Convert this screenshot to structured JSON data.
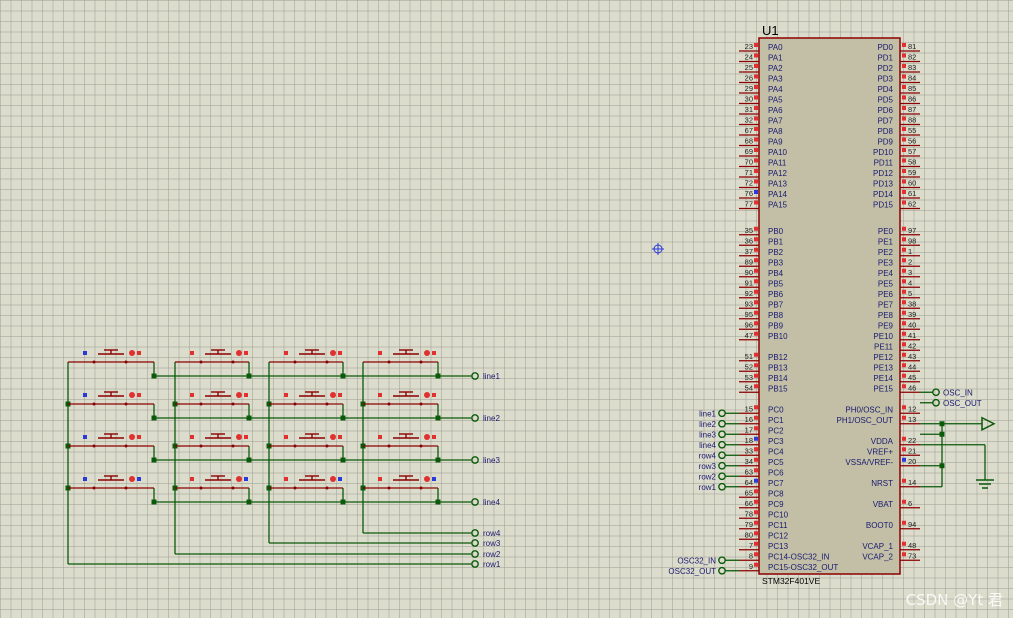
{
  "chip": {
    "ref": "U1",
    "part": "STM32F401VE",
    "left_pins": [
      {
        "num": "23",
        "name": "PA0"
      },
      {
        "num": "24",
        "name": "PA1"
      },
      {
        "num": "25",
        "name": "PA2"
      },
      {
        "num": "26",
        "name": "PA3"
      },
      {
        "num": "29",
        "name": "PA4"
      },
      {
        "num": "30",
        "name": "PA5"
      },
      {
        "num": "31",
        "name": "PA6"
      },
      {
        "num": "32",
        "name": "PA7"
      },
      {
        "num": "67",
        "name": "PA8"
      },
      {
        "num": "68",
        "name": "PA9"
      },
      {
        "num": "69",
        "name": "PA10"
      },
      {
        "num": "70",
        "name": "PA11"
      },
      {
        "num": "71",
        "name": "PA12"
      },
      {
        "num": "72",
        "name": "PA13"
      },
      {
        "num": "76",
        "name": "PA14"
      },
      {
        "num": "77",
        "name": "PA15"
      },
      {
        "num": "35",
        "name": "PB0"
      },
      {
        "num": "36",
        "name": "PB1"
      },
      {
        "num": "37",
        "name": "PB2"
      },
      {
        "num": "89",
        "name": "PB3"
      },
      {
        "num": "90",
        "name": "PB4"
      },
      {
        "num": "91",
        "name": "PB5"
      },
      {
        "num": "92",
        "name": "PB6"
      },
      {
        "num": "93",
        "name": "PB7"
      },
      {
        "num": "95",
        "name": "PB8"
      },
      {
        "num": "96",
        "name": "PB9"
      },
      {
        "num": "47",
        "name": "PB10"
      },
      {
        "num": "51",
        "name": "PB12"
      },
      {
        "num": "52",
        "name": "PB13"
      },
      {
        "num": "53",
        "name": "PB14"
      },
      {
        "num": "54",
        "name": "PB15"
      },
      {
        "num": "15",
        "name": "PC0"
      },
      {
        "num": "16",
        "name": "PC1"
      },
      {
        "num": "17",
        "name": "PC2"
      },
      {
        "num": "18",
        "name": "PC3"
      },
      {
        "num": "33",
        "name": "PC4"
      },
      {
        "num": "34",
        "name": "PC5"
      },
      {
        "num": "63",
        "name": "PC6"
      },
      {
        "num": "64",
        "name": "PC7"
      },
      {
        "num": "65",
        "name": "PC8"
      },
      {
        "num": "66",
        "name": "PC9"
      },
      {
        "num": "78",
        "name": "PC10"
      },
      {
        "num": "79",
        "name": "PC11"
      },
      {
        "num": "80",
        "name": "PC12"
      },
      {
        "num": "7",
        "name": "PC13"
      },
      {
        "num": "8",
        "name": "PC14-OSC32_IN"
      },
      {
        "num": "9",
        "name": "PC15-OSC32_OUT"
      }
    ],
    "right_pins": [
      {
        "num": "81",
        "name": "PD0"
      },
      {
        "num": "82",
        "name": "PD1"
      },
      {
        "num": "83",
        "name": "PD2"
      },
      {
        "num": "84",
        "name": "PD3"
      },
      {
        "num": "85",
        "name": "PD4"
      },
      {
        "num": "86",
        "name": "PD5"
      },
      {
        "num": "87",
        "name": "PD6"
      },
      {
        "num": "88",
        "name": "PD7"
      },
      {
        "num": "55",
        "name": "PD8"
      },
      {
        "num": "56",
        "name": "PD9"
      },
      {
        "num": "57",
        "name": "PD10"
      },
      {
        "num": "58",
        "name": "PD11"
      },
      {
        "num": "59",
        "name": "PD12"
      },
      {
        "num": "60",
        "name": "PD13"
      },
      {
        "num": "61",
        "name": "PD14"
      },
      {
        "num": "62",
        "name": "PD15"
      },
      {
        "num": "97",
        "name": "PE0"
      },
      {
        "num": "98",
        "name": "PE1"
      },
      {
        "num": "1",
        "name": "PE2"
      },
      {
        "num": "2",
        "name": "PE3"
      },
      {
        "num": "3",
        "name": "PE4"
      },
      {
        "num": "4",
        "name": "PE5"
      },
      {
        "num": "5",
        "name": "PE6"
      },
      {
        "num": "38",
        "name": "PE7"
      },
      {
        "num": "39",
        "name": "PE8"
      },
      {
        "num": "40",
        "name": "PE9"
      },
      {
        "num": "41",
        "name": "PE10"
      },
      {
        "num": "42",
        "name": "PE11"
      },
      {
        "num": "43",
        "name": "PE12"
      },
      {
        "num": "44",
        "name": "PE13"
      },
      {
        "num": "45",
        "name": "PE14"
      },
      {
        "num": "46",
        "name": "PE15"
      },
      {
        "num": "12",
        "name": "PH0/OSC_IN"
      },
      {
        "num": "13",
        "name": "PH1/OSC_OUT"
      },
      {
        "num": "22",
        "name": "VDDA"
      },
      {
        "num": "21",
        "name": "VREF+"
      },
      {
        "num": "20",
        "name": "VSSA/VREF-"
      },
      {
        "num": "14",
        "name": "NRST"
      },
      {
        "num": "6",
        "name": "VBAT"
      },
      {
        "num": "94",
        "name": "BOOT0"
      },
      {
        "num": "48",
        "name": "VCAP_1"
      },
      {
        "num": "73",
        "name": "VCAP_2"
      }
    ]
  },
  "left_terminals": [
    "line1",
    "line2",
    "line3",
    "line4",
    "row4",
    "row3",
    "row2",
    "row1",
    "OSC32_IN",
    "OSC32_OUT"
  ],
  "right_terminals": [
    "OSC_IN",
    "OSC_OUT"
  ],
  "keypad_lines": [
    "line1",
    "line2",
    "line3",
    "line4"
  ],
  "keypad_rows": [
    "row4",
    "row3",
    "row2",
    "row1"
  ],
  "watermark": "CSDN @Yt 君",
  "colors": {
    "background": "#dcdccd",
    "chip_fill": "#c2bfa6",
    "chip_border": "#8b0000",
    "wire": "#0a5a0a",
    "pin_text": "#1a1a70",
    "pin_marker": "#e03030",
    "pin_marker_blue": "#2a3ad8"
  }
}
